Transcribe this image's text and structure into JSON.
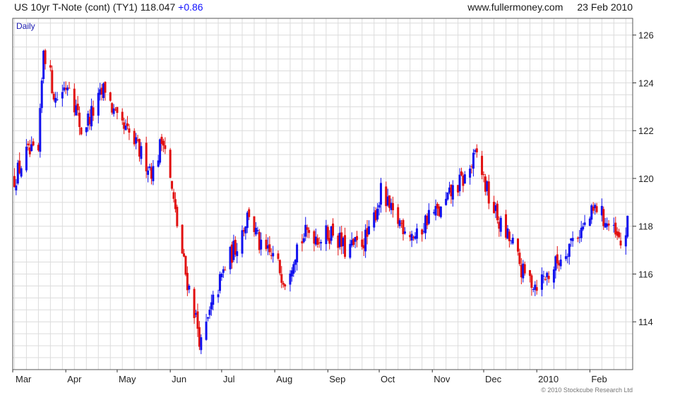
{
  "header": {
    "title": "US 10yr T-Note (cont) (TY1)",
    "last_price": "118.047",
    "change": "+0.86",
    "source": "www.fullermoney.com",
    "date": "23 Feb 2010"
  },
  "footer": {
    "copyright": "© 2010 Stockcube Research Ltd"
  },
  "colors": {
    "up": "#1010ee",
    "down": "#e11010",
    "grid": "#dcdcdc",
    "frame": "#555555"
  },
  "chart_data": {
    "type": "line",
    "style": "candlestick (up=blue, down=red)",
    "title": "US 10yr T-Note (cont) (TY1)",
    "period_label": "Daily",
    "xlabel": "",
    "ylabel": "",
    "ylim": [
      112.0,
      126.7
    ],
    "yticks": [
      114,
      116,
      118,
      120,
      122,
      124,
      126
    ],
    "x_month_labels": [
      "Mar",
      "Apr",
      "May",
      "Jun",
      "Jul",
      "Aug",
      "Sep",
      "Oct",
      "Nov",
      "Dec",
      "2010",
      "Feb"
    ],
    "grid": true,
    "axis_side": "right",
    "closes_approx": [
      {
        "date": "2009-03-02",
        "close": 120.0
      },
      {
        "date": "2009-03-09",
        "close": 121.0
      },
      {
        "date": "2009-03-16",
        "close": 121.0
      },
      {
        "date": "2009-03-19",
        "close": 125.5
      },
      {
        "date": "2009-03-26",
        "close": 123.3
      },
      {
        "date": "2009-04-03",
        "close": 124.1
      },
      {
        "date": "2009-04-10",
        "close": 122.0
      },
      {
        "date": "2009-04-17",
        "close": 122.8
      },
      {
        "date": "2009-04-24",
        "close": 123.8
      },
      {
        "date": "2009-05-01",
        "close": 122.3
      },
      {
        "date": "2009-05-08",
        "close": 121.8
      },
      {
        "date": "2009-05-15",
        "close": 121.0
      },
      {
        "date": "2009-05-22",
        "close": 120.3
      },
      {
        "date": "2009-05-28",
        "close": 121.8
      },
      {
        "date": "2009-06-04",
        "close": 118.5
      },
      {
        "date": "2009-06-10",
        "close": 116.0
      },
      {
        "date": "2009-06-15",
        "close": 114.5
      },
      {
        "date": "2009-06-19",
        "close": 113.0
      },
      {
        "date": "2009-06-26",
        "close": 114.8
      },
      {
        "date": "2009-07-03",
        "close": 116.3
      },
      {
        "date": "2009-07-10",
        "close": 117.3
      },
      {
        "date": "2009-07-17",
        "close": 118.6
      },
      {
        "date": "2009-07-24",
        "close": 117.0
      },
      {
        "date": "2009-07-31",
        "close": 116.7
      },
      {
        "date": "2009-08-07",
        "close": 115.8
      },
      {
        "date": "2009-08-14",
        "close": 117.2
      },
      {
        "date": "2009-08-21",
        "close": 117.8
      },
      {
        "date": "2009-08-28",
        "close": 117.5
      },
      {
        "date": "2009-09-04",
        "close": 117.8
      },
      {
        "date": "2009-09-11",
        "close": 117.0
      },
      {
        "date": "2009-09-18",
        "close": 117.2
      },
      {
        "date": "2009-09-25",
        "close": 117.6
      },
      {
        "date": "2009-10-02",
        "close": 119.4
      },
      {
        "date": "2009-10-09",
        "close": 118.4
      },
      {
        "date": "2009-10-16",
        "close": 118.0
      },
      {
        "date": "2009-10-23",
        "close": 117.5
      },
      {
        "date": "2009-10-30",
        "close": 118.5
      },
      {
        "date": "2009-11-06",
        "close": 118.6
      },
      {
        "date": "2009-11-13",
        "close": 119.5
      },
      {
        "date": "2009-11-20",
        "close": 120.0
      },
      {
        "date": "2009-11-27",
        "close": 121.0
      },
      {
        "date": "2009-12-04",
        "close": 119.2
      },
      {
        "date": "2009-12-11",
        "close": 118.0
      },
      {
        "date": "2009-12-18",
        "close": 117.2
      },
      {
        "date": "2009-12-24",
        "close": 116.0
      },
      {
        "date": "2009-12-31",
        "close": 115.6
      },
      {
        "date": "2010-01-08",
        "close": 116.0
      },
      {
        "date": "2010-01-15",
        "close": 116.7
      },
      {
        "date": "2010-01-22",
        "close": 117.5
      },
      {
        "date": "2010-01-29",
        "close": 118.0
      },
      {
        "date": "2010-02-05",
        "close": 118.8
      },
      {
        "date": "2010-02-12",
        "close": 118.0
      },
      {
        "date": "2010-02-19",
        "close": 117.2
      },
      {
        "date": "2010-02-23",
        "close": 118.0
      }
    ]
  }
}
